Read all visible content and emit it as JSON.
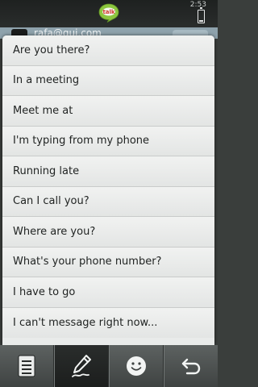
{
  "status_bar": {
    "time": "2:53",
    "app_icon": "chat-talk-logo",
    "app_logo_text": "talk",
    "battery_icon": "battery-icon"
  },
  "chat_header": {
    "contact": "rafa@gui.com",
    "avatar": "avatar"
  },
  "menu": {
    "items": [
      {
        "label": "Are you there?"
      },
      {
        "label": "In a meeting"
      },
      {
        "label": "Meet me at"
      },
      {
        "label": "I'm typing from my phone"
      },
      {
        "label": "Running late"
      },
      {
        "label": "Can I call you?"
      },
      {
        "label": "Where are you?"
      },
      {
        "label": "What's your phone number?"
      },
      {
        "label": "I have to go"
      },
      {
        "label": "I can't message right now..."
      }
    ]
  },
  "toolbar": {
    "buttons": [
      {
        "icon": "menu-list-icon",
        "active": false
      },
      {
        "icon": "pen-write-icon",
        "active": true
      },
      {
        "icon": "smiley-icon",
        "active": false
      },
      {
        "icon": "back-arrow-icon",
        "active": false
      }
    ]
  },
  "colors": {
    "menu_background": "#e9ebea",
    "toolbar_background": "#4a4f4e",
    "header_background": "#8ea2ac",
    "logo_green": "#8cc63e",
    "logo_red": "#d23b2f"
  }
}
